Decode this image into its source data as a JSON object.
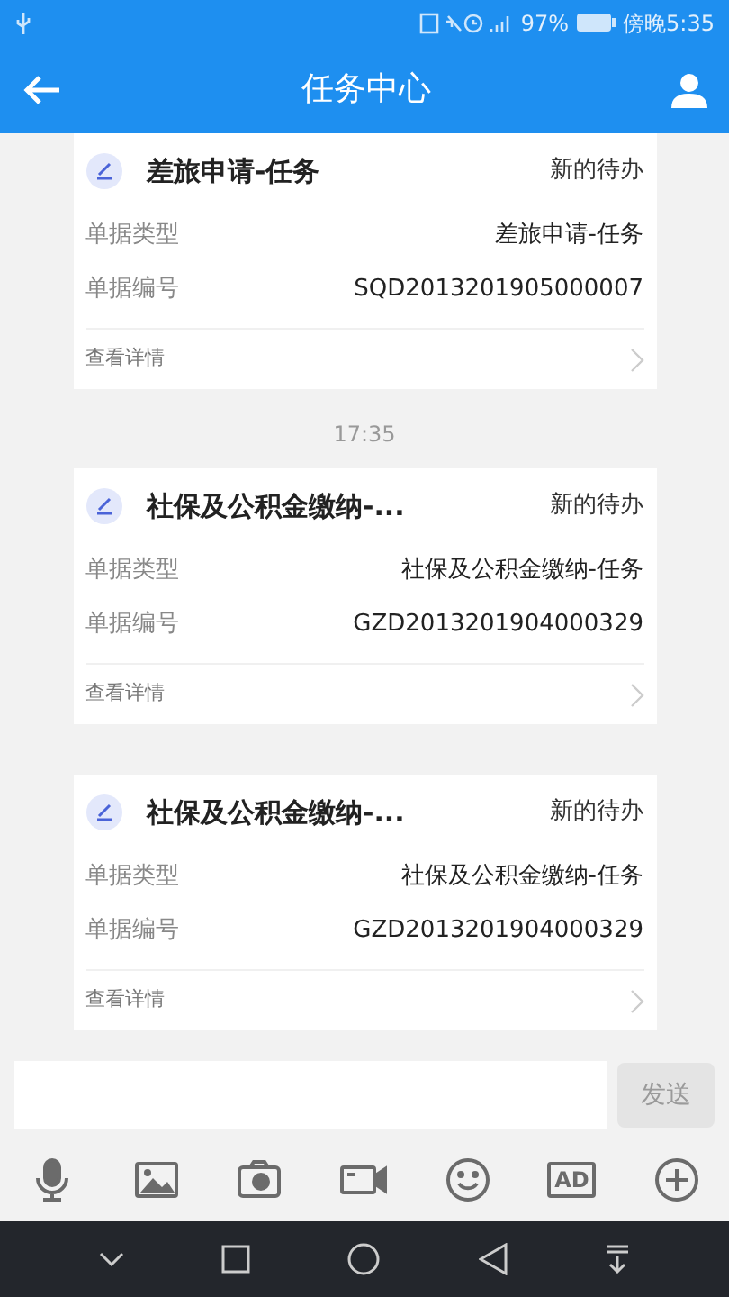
{
  "status_bar": {
    "battery": "97%",
    "time": "傍晚5:35"
  },
  "header": {
    "title": "任务中心"
  },
  "messages": [
    {
      "title": "差旅申请-任务",
      "status": "新的待办",
      "fields": [
        {
          "label": "单据类型",
          "value": "差旅申请-任务"
        },
        {
          "label": "单据编号",
          "value": "SQD2013201905000007"
        }
      ],
      "link": "查看详情"
    },
    {
      "timestamp": "17:35",
      "title": "社保及公积金缴纳-...",
      "status": "新的待办",
      "fields": [
        {
          "label": "单据类型",
          "value": "社保及公积金缴纳-任务"
        },
        {
          "label": "单据编号",
          "value": "GZD2013201904000329"
        }
      ],
      "link": "查看详情"
    },
    {
      "title": "社保及公积金缴纳-...",
      "status": "新的待办",
      "fields": [
        {
          "label": "单据类型",
          "value": "社保及公积金缴纳-任务"
        },
        {
          "label": "单据编号",
          "value": "GZD2013201904000329"
        }
      ],
      "link": "查看详情"
    }
  ],
  "composer": {
    "send_button": {
      "label": "发送",
      "disabled": true
    }
  },
  "toolbar": [
    {
      "kind": "mic"
    },
    {
      "kind": "image"
    },
    {
      "kind": "camera"
    },
    {
      "kind": "video"
    },
    {
      "kind": "emoji"
    },
    {
      "kind": "ad",
      "label": "AD"
    },
    {
      "kind": "plus"
    }
  ]
}
